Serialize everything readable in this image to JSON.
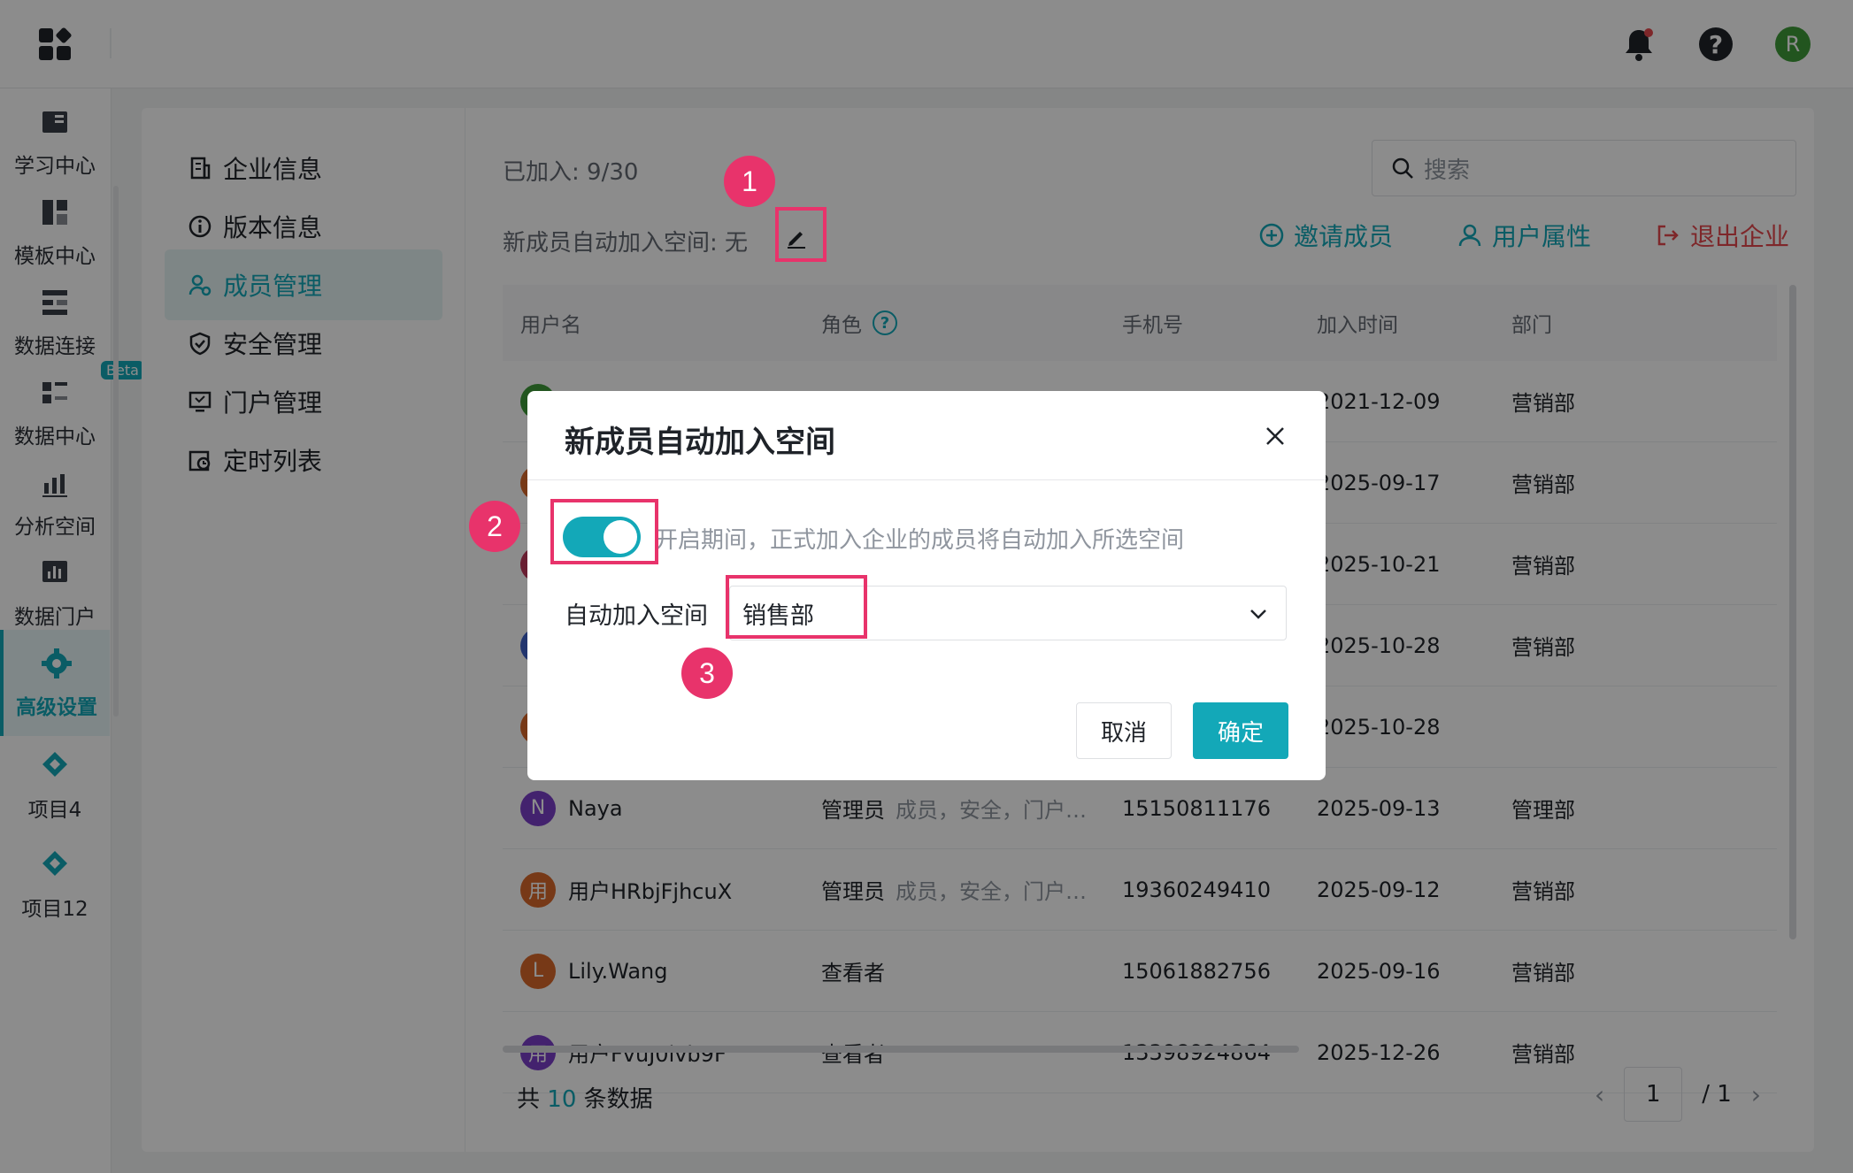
{
  "topbar": {
    "icons": [
      "apps-grid-icon",
      "bell-icon",
      "help-icon",
      "avatar"
    ],
    "avatar_letter": "R"
  },
  "rail": {
    "items": [
      {
        "label": "学习中心",
        "icon": "book-icon"
      },
      {
        "label": "模板中心",
        "icon": "template-icon"
      },
      {
        "label": "数据连接",
        "icon": "data-connect-icon"
      },
      {
        "label": "数据中心",
        "icon": "data-center-icon",
        "badge": "Beta"
      },
      {
        "label": "分析空间",
        "icon": "analysis-icon"
      },
      {
        "label": "数据门户",
        "icon": "portal-icon"
      },
      {
        "label": "高级设置",
        "icon": "gear-icon",
        "active": true
      },
      {
        "label": "项目4",
        "icon": "project-icon"
      },
      {
        "label": "项目12",
        "icon": "project-icon"
      }
    ]
  },
  "subnav": {
    "items": [
      {
        "label": "企业信息",
        "icon": "building-icon"
      },
      {
        "label": "版本信息",
        "icon": "info-icon"
      },
      {
        "label": "成员管理",
        "icon": "members-icon",
        "active": true
      },
      {
        "label": "安全管理",
        "icon": "shield-icon"
      },
      {
        "label": "门户管理",
        "icon": "portal-icon"
      },
      {
        "label": "定时列表",
        "icon": "schedule-icon"
      }
    ]
  },
  "main": {
    "joined": "已加入: 9/30",
    "autojoin": "新成员自动加入空间: 无",
    "search_placeholder": "搜索",
    "actions": {
      "invite": "邀请成员",
      "attrs": "用户属性",
      "exit": "退出企业"
    },
    "columns": {
      "username": "用户名",
      "role": "角色",
      "phone": "手机号",
      "joined": "加入时间",
      "dept": "部门"
    },
    "rows": [
      {
        "avatar": "",
        "color": "#3f9b39",
        "name": "",
        "role": "",
        "perm": "",
        "phone": "",
        "date": "2021-12-09",
        "dept": "营销部"
      },
      {
        "avatar": "",
        "color": "#d9692b",
        "name": "",
        "role": "",
        "perm": "",
        "phone": "",
        "date": "2025-09-17",
        "dept": "营销部"
      },
      {
        "avatar": "",
        "color": "#c0395b",
        "name": "",
        "role": "",
        "perm": "",
        "phone": "",
        "date": "2025-10-21",
        "dept": "营销部"
      },
      {
        "avatar": "",
        "color": "#3f62c9",
        "name": "",
        "role": "",
        "perm": "",
        "phone": "",
        "date": "2025-10-28",
        "dept": "营销部"
      },
      {
        "avatar": "",
        "color": "#d9692b",
        "name": "",
        "role": "",
        "perm": "",
        "phone": "",
        "date": "2025-10-28",
        "dept": ""
      },
      {
        "avatar": "N",
        "color": "#7b3fc9",
        "name": "Naya",
        "role": "管理员",
        "perm": "成员，安全，门户…",
        "phone": "15150811176",
        "date": "2025-09-13",
        "dept": "管理部"
      },
      {
        "avatar": "用",
        "color": "#d9692b",
        "name": "用户HRbjFjhcuX",
        "role": "管理员",
        "perm": "成员，安全，门户…",
        "phone": "19360249410",
        "date": "2025-09-12",
        "dept": "营销部"
      },
      {
        "avatar": "L",
        "color": "#d9692b",
        "name": "Lily.Wang",
        "role": "查看者",
        "perm": "",
        "phone": "15061882756",
        "date": "2025-09-16",
        "dept": "营销部"
      },
      {
        "avatar": "用",
        "color": "#7b3fc9",
        "name": "用户FvuJ0ivb9F",
        "role": "查看者",
        "perm": "",
        "phone": "13398924864",
        "date": "2025-12-26",
        "dept": "营销部"
      }
    ],
    "total_prefix": "共",
    "total_count": "10",
    "total_suffix": "条数据",
    "page_current": "1",
    "page_total": "/ 1"
  },
  "modal": {
    "title": "新成员自动加入空间",
    "toggle_desc": "开启期间，正式加入企业的成员将自动加入所选空间",
    "field_label": "自动加入空间",
    "selected_value": "销售部",
    "cancel_label": "取消",
    "ok_label": "确定",
    "toggle_on": true
  },
  "annotations": [
    "1",
    "2",
    "3"
  ],
  "colors": {
    "accent": "#13a8b8",
    "danger": "#e5484d",
    "annotation": "#e8336b"
  }
}
